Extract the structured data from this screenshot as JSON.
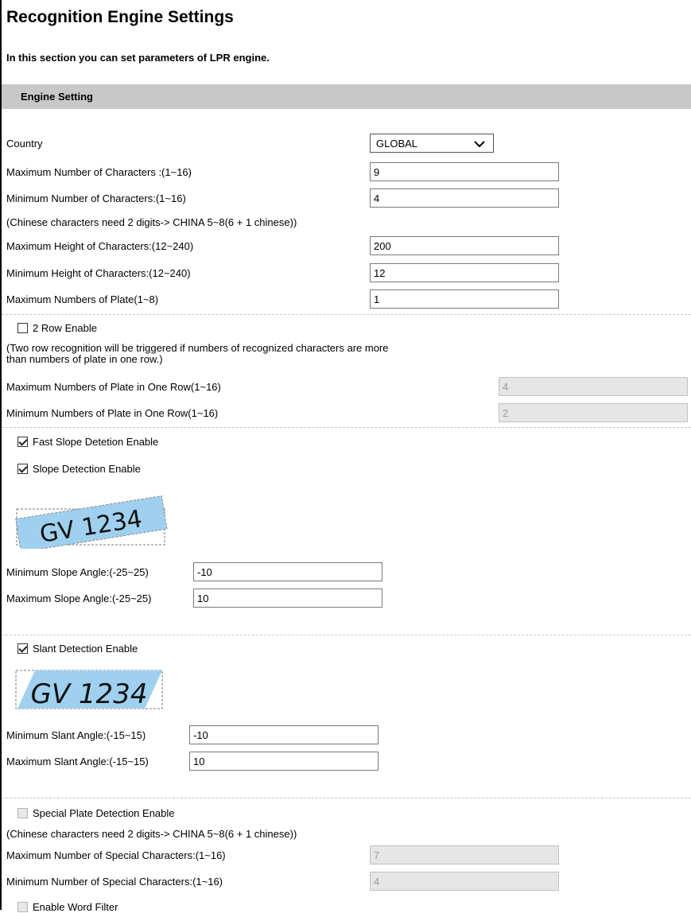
{
  "page": {
    "title": "Recognition Engine Settings",
    "intro": "In this section you can set parameters of LPR engine."
  },
  "section": {
    "title": "Engine Setting"
  },
  "country": {
    "label": "Country",
    "value": "GLOBAL"
  },
  "fields": {
    "max_chars": {
      "label": "Maximum Number of Characters :(1~16)",
      "value": "9"
    },
    "min_chars": {
      "label": "Minimum Number of Characters:(1~16)",
      "value": "4"
    },
    "chinese_note": "(Chinese characters need 2 digits-> CHINA 5~8(6 + 1 chinese))",
    "max_height": {
      "label": "Maximum Height of Characters:(12~240)",
      "value": "200"
    },
    "min_height": {
      "label": "Minimum Height of Characters:(12~240)",
      "value": "12"
    },
    "max_plates": {
      "label": "Maximum Numbers of Plate(1~8)",
      "value": "1"
    }
  },
  "two_row": {
    "label": "2 Row Enable",
    "checked": false,
    "note_line1": "(Two row recognition will be triggered if numbers of recognized characters are more",
    "note_line2": "than numbers of plate in one row.)",
    "max": {
      "label": "Maximum Numbers of Plate in One Row(1~16)",
      "value": "4"
    },
    "min": {
      "label": "Minimum Numbers of Plate in One Row(1~16)",
      "value": "2"
    }
  },
  "fast_slope": {
    "label": "Fast Slope Detetion Enable",
    "checked": true
  },
  "slope": {
    "label": "Slope Detection Enable",
    "checked": true,
    "plate_text": "GV 1234",
    "min": {
      "label": "Minimum Slope Angle:(-25~25)",
      "value": "-10"
    },
    "max": {
      "label": "Maximum Slope Angle:(-25~25)",
      "value": "10"
    }
  },
  "slant": {
    "label": "Slant Detection Enable",
    "checked": true,
    "plate_text": "GV 1234",
    "min": {
      "label": "Minimum Slant Angle:(-15~15)",
      "value": "-10"
    },
    "max": {
      "label": "Maximum Slant Angle:(-15~15)",
      "value": "10"
    }
  },
  "special": {
    "label": "Special Plate Detection Enable",
    "checked": false,
    "note": "(Chinese characters need 2 digits-> CHINA 5~8(6 + 1 chinese))",
    "max": {
      "label": "Maximum Number of Special Characters:(1~16)",
      "value": "7"
    },
    "min": {
      "label": "Minimum Number of Special Characters:(1~16)",
      "value": "4"
    }
  },
  "word_filter": {
    "label": "Enable Word Filter",
    "checked": false
  },
  "colors": {
    "section_bar": "#c8c8c8",
    "plate_fill": "#9fd0ef",
    "disabled_field": "#e6e6e6"
  },
  "icons": {
    "dropdown": "chevron-down-icon"
  }
}
